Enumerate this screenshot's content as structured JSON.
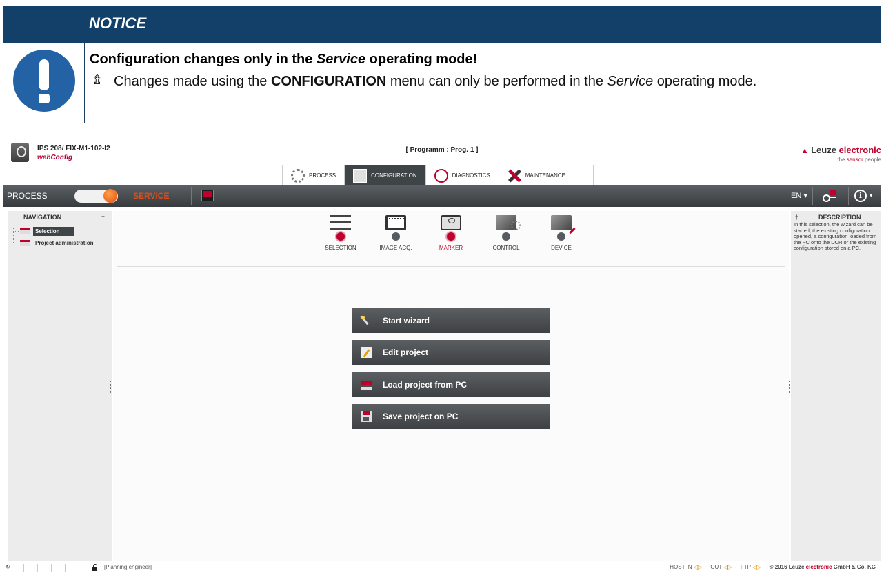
{
  "notice": {
    "title": "NOTICE",
    "heading_pre": "Configuration changes only in the ",
    "heading_em": "Service",
    "heading_post": " operating mode!",
    "arrow_glyph": "⇯",
    "body_pre": "Changes made using the ",
    "body_strong": "CONFIGURATION",
    "body_mid": " menu can only be performed in the ",
    "body_em": "Service",
    "body_post": " op­erating mode."
  },
  "app": {
    "device_name_pre": "IPS 208",
    "device_name_i": "i",
    "device_name_post": " FIX-M1-102-I2",
    "subtitle": "webConfig",
    "program_title": "[ Programm : Prog. 1 ]",
    "brand_pre": "Leuze ",
    "brand_red": "electronic",
    "slogan_pre": "the ",
    "slogan_red": "sensor",
    "slogan_post": " people"
  },
  "tabs": [
    {
      "label": "PROCESS",
      "icon": "gear-icon",
      "active": false
    },
    {
      "label": "CONFIGURATION",
      "icon": "config-icon",
      "active": true
    },
    {
      "label": "DIAGNOSTICS",
      "icon": "stethoscope-icon",
      "active": false
    },
    {
      "label": "MAINTENANCE",
      "icon": "tools-icon",
      "active": false
    }
  ],
  "toolbar": {
    "process_label": "PROCESS",
    "service_label": "SERVICE",
    "mode": "SERVICE",
    "language": "EN ▾",
    "info_glyph": "i",
    "info_caret": "▾"
  },
  "navigation": {
    "title": "NAVIGATION",
    "pin_glyph": "†",
    "items": [
      {
        "label": "Selection",
        "selected": true
      },
      {
        "label": "Project administration",
        "selected": false
      }
    ]
  },
  "wizard_steps": [
    {
      "label": "SELECTION",
      "icon": "list-icon",
      "done": true,
      "current": false
    },
    {
      "label": "IMAGE ACQ.",
      "icon": "film-icon",
      "done": false,
      "current": false
    },
    {
      "label": "MARKER",
      "icon": "camera-icon",
      "done": true,
      "current": true
    },
    {
      "label": "CONTROL",
      "icon": "control-icon",
      "done": false,
      "current": false
    },
    {
      "label": "DEVICE",
      "icon": "device-icon",
      "done": false,
      "current": false
    }
  ],
  "actions": [
    {
      "label": "Start wizard",
      "icon": "wand-icon"
    },
    {
      "label": "Edit project",
      "icon": "edit-icon"
    },
    {
      "label": "Load project from PC",
      "icon": "load-icon"
    },
    {
      "label": "Save project on PC",
      "icon": "save-icon"
    }
  ],
  "description": {
    "title": "DESCRIPTION",
    "pin_glyph": "†",
    "text": "In this selection, the wizard can be started, the existing configuration opened, a configuration loaded from the PC onto the DCR or the existing configuration stored on a PC."
  },
  "statusbar": {
    "refresh_glyph": "↻",
    "role": "[Planning engineer]",
    "host_in": "HOST IN",
    "out": "OUT",
    "ftp": "FTP",
    "io_glyph": "◁▷",
    "copyright_pre": "© 2016 Leuze ",
    "copyright_red": "electronic",
    "copyright_post": " GmbH & Co. KG"
  },
  "colors": {
    "notice_header": "#124069",
    "notice_icon": "#2363a5",
    "brand_red": "#c0002c",
    "service_orange": "#e74b13",
    "toolbar": "#474b4e"
  }
}
